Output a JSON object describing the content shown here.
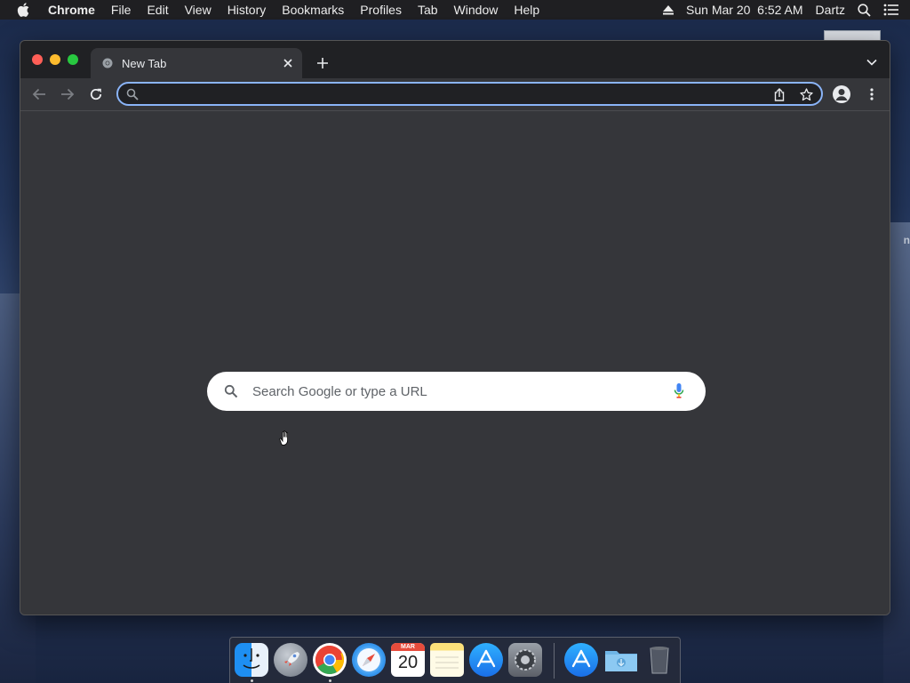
{
  "menubar": {
    "app_name": "Chrome",
    "menus": [
      "File",
      "Edit",
      "View",
      "History",
      "Bookmarks",
      "Profiles",
      "Tab",
      "Window",
      "Help"
    ],
    "datetime": "Sun Mar 20  6:52 AM",
    "user": "Dartz"
  },
  "desktop": {
    "partial_label": "n"
  },
  "browser": {
    "tab_title": "New Tab",
    "omnibox_value": "",
    "ntp_search_placeholder": "Search Google or type a URL",
    "omnibox_focus_color": "#8ab4f8"
  },
  "dock": {
    "calendar_month": "MAR",
    "calendar_day": "20",
    "items": [
      "finder-icon",
      "launchpad-icon",
      "chrome-icon",
      "safari-icon",
      "calendar-icon",
      "notes-icon",
      "app-store-icon",
      "system-preferences-icon",
      "app-store-downloads-icon",
      "downloads-folder-icon",
      "trash-icon"
    ]
  }
}
